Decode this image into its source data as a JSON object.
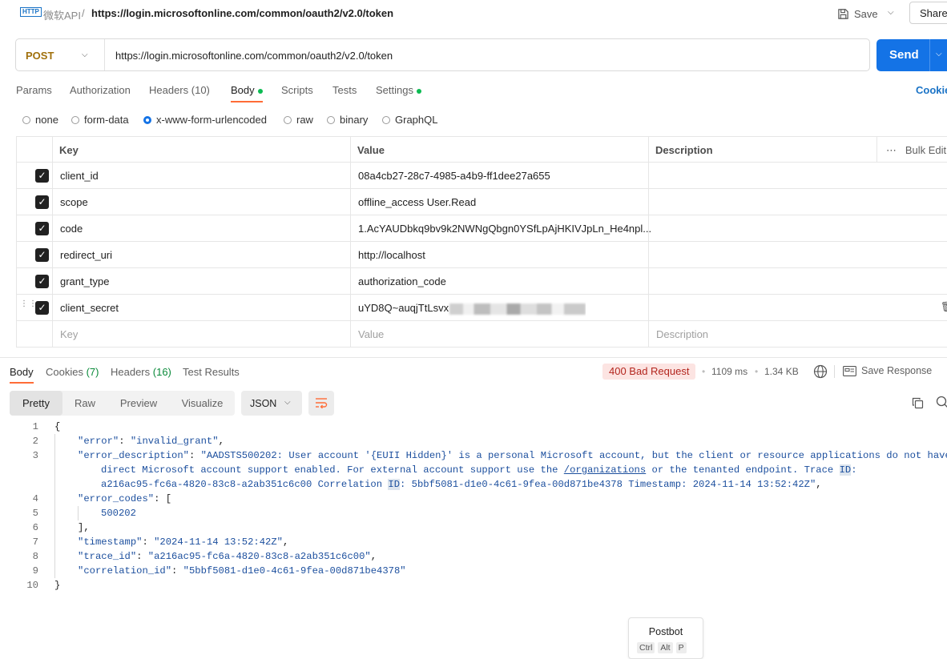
{
  "header": {
    "http_badge": "HTTP",
    "collection": "微软API",
    "separator": "/",
    "request_name": "https://login.microsoftonline.com/common/oauth2/v2.0/token",
    "save_label": "Save",
    "share_label": "Share"
  },
  "request": {
    "method": "POST",
    "url": "https://login.microsoftonline.com/common/oauth2/v2.0/token",
    "send_label": "Send"
  },
  "tabs": {
    "params": "Params",
    "authorization": "Authorization",
    "headers": "Headers",
    "headers_count": "(10)",
    "body": "Body",
    "scripts": "Scripts",
    "tests": "Tests",
    "settings": "Settings",
    "cookies": "Cookies"
  },
  "body_types": [
    "none",
    "form-data",
    "x-www-form-urlencoded",
    "raw",
    "binary",
    "GraphQL"
  ],
  "body_type_selected": "x-www-form-urlencoded",
  "params_table": {
    "headers": {
      "key": "Key",
      "value": "Value",
      "description": "Description",
      "bulk_edit": "Bulk Edit"
    },
    "rows": [
      {
        "key": "client_id",
        "value": "08a4cb27-28c7-4985-a4b9-ff1dee27a655",
        "checked": true
      },
      {
        "key": "scope",
        "value": "offline_access User.Read",
        "checked": true
      },
      {
        "key": "code",
        "value": "1.AcYAUDbkq9bv9k2NWNgQbgn0YSfLpAjHKIVJpLn_He4npl...",
        "checked": true
      },
      {
        "key": "redirect_uri",
        "value": "http://localhost",
        "checked": true
      },
      {
        "key": "grant_type",
        "value": "authorization_code",
        "checked": true
      },
      {
        "key": "client_secret",
        "value": "uYD8Q~auqjTtLsvx",
        "checked": true
      }
    ],
    "placeholders": {
      "key": "Key",
      "value": "Value",
      "description": "Description"
    }
  },
  "response": {
    "tabs": {
      "body": "Body",
      "cookies": "Cookies",
      "cookies_count": "(7)",
      "headers": "Headers",
      "headers_count": "(16)",
      "test_results": "Test Results"
    },
    "status": "400 Bad Request",
    "time": "1109 ms",
    "size": "1.34 KB",
    "save_response": "Save Response",
    "views": [
      "Pretty",
      "Raw",
      "Preview",
      "Visualize"
    ],
    "view_selected": "Pretty",
    "format": "JSON"
  },
  "code": {
    "l1": "{",
    "error_key": "\"error\"",
    "error_val": "\"invalid_grant\"",
    "desc_key": "\"error_description\"",
    "desc_a": "\"AADSTS500202: User account '{EUII Hidden}' is a personal Microsoft account, but the client or resource applications do not have",
    "desc_b1": "direct Microsoft account support enabled. For external account support use the ",
    "desc_b_link": "/organizations",
    "desc_b2": " or the tenanted endpoint. Trace ",
    "desc_id1": "ID",
    "desc_b3": ":",
    "desc_c1": "a216ac95-fc6a-4820-83c8-a2ab351c6c00 Correlation ",
    "desc_id2": "ID",
    "desc_c2": ": 5bbf5081-d1e0-4c61-9fea-00d871be4378 Timestamp: 2024-11-14 13:52:42Z\"",
    "codes_key": "\"error_codes\"",
    "codes_open": "[",
    "code_val": "500202",
    "codes_close": "],",
    "ts_key": "\"timestamp\"",
    "ts_val": "\"2024-11-14 13:52:42Z\"",
    "trace_key": "\"trace_id\"",
    "trace_val": "\"a216ac95-fc6a-4820-83c8-a2ab351c6c00\"",
    "corr_key": "\"correlation_id\"",
    "corr_val": "\"5bbf5081-d1e0-4c61-9fea-00d871be4378\"",
    "l10": "}",
    "line_numbers": [
      "1",
      "2",
      "3",
      "4",
      "5",
      "6",
      "7",
      "8",
      "9",
      "10"
    ]
  },
  "postbot": {
    "label": "Postbot",
    "keys": [
      "Ctrl",
      "Alt",
      "P"
    ]
  },
  "colors": {
    "accent_orange": "#ff6c37",
    "send_blue": "#1473e6",
    "method_post": "#a0700c",
    "error_red": "#b3261e"
  }
}
